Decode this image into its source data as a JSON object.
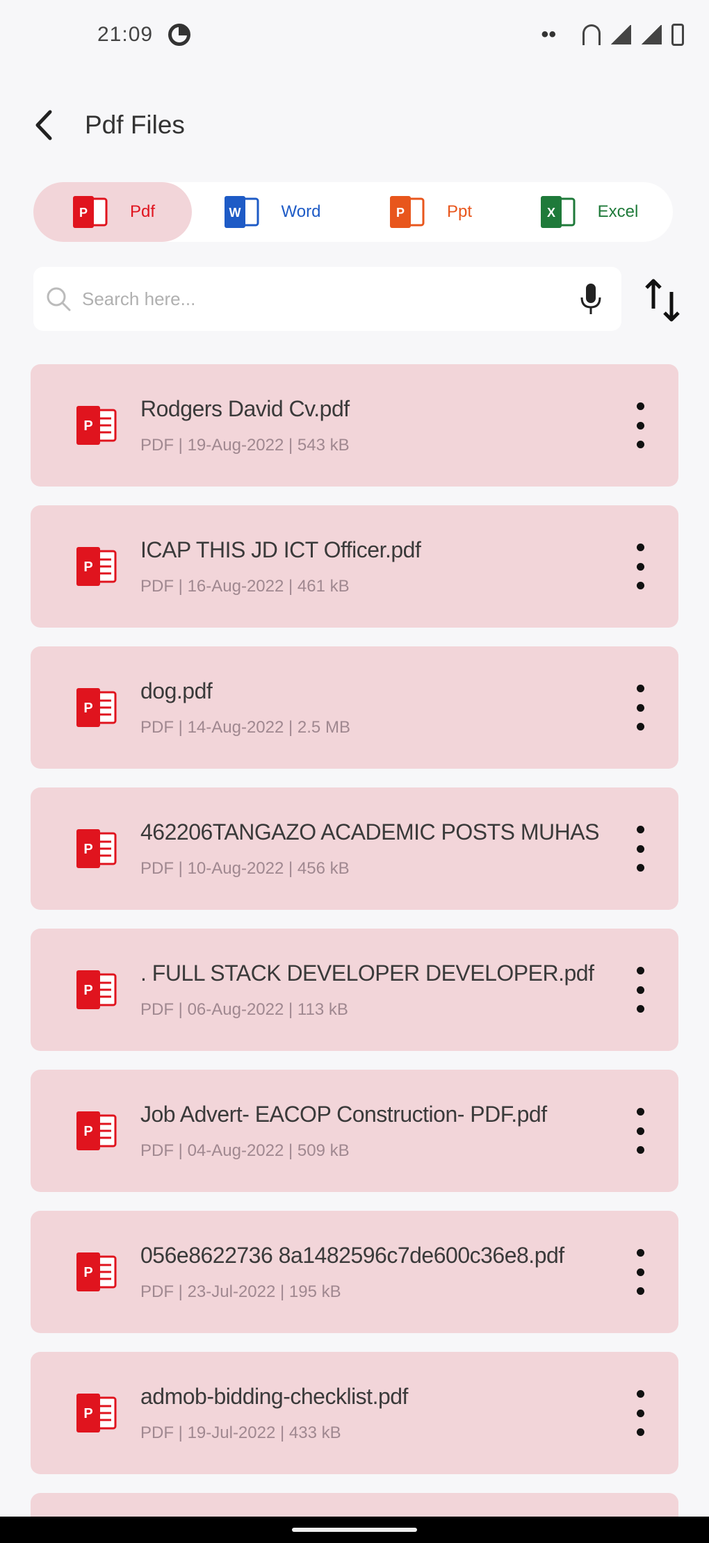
{
  "status_bar": {
    "time": "21:09",
    "icons": [
      "data-saver-icon",
      "more-icon",
      "wifi-icon",
      "signal-icon",
      "signal-icon",
      "battery-icon"
    ]
  },
  "header": {
    "title": "Pdf Files",
    "back_icon": "arrow-back-icon"
  },
  "tabs": [
    {
      "label": "Pdf",
      "icon": "pdf-icon",
      "color": "#e0141e",
      "active": true
    },
    {
      "label": "Word",
      "icon": "word-icon",
      "color": "#1e5bc6",
      "active": false
    },
    {
      "label": "Ppt",
      "icon": "ppt-icon",
      "color": "#e8561c",
      "active": false
    },
    {
      "label": "Excel",
      "icon": "excel-icon",
      "color": "#1f7a3a",
      "active": false
    }
  ],
  "search": {
    "placeholder": "Search here...",
    "value": ""
  },
  "files": [
    {
      "name": "Rodgers David Cv.pdf",
      "meta": "PDF  |  19-Aug-2022  |  543 kB"
    },
    {
      "name": "ICAP THIS JD ICT Officer.pdf",
      "meta": "PDF  |  16-Aug-2022  |  461 kB"
    },
    {
      "name": "dog.pdf",
      "meta": "PDF  |  14-Aug-2022  |  2.5 MB"
    },
    {
      "name": "462206TANGAZO ACADEMIC POSTS MUHAS",
      "meta": "PDF  |  10-Aug-2022  |  456 kB"
    },
    {
      "name": ". FULL STACK DEVELOPER DEVELOPER.pdf",
      "meta": "PDF  |  06-Aug-2022  |  113 kB"
    },
    {
      "name": "Job Advert- EACOP Construction- PDF.pdf",
      "meta": "PDF  |  04-Aug-2022  |  509 kB"
    },
    {
      "name": "056e8622736 8a1482596c7de600c36e8.pdf",
      "meta": "PDF  |  23-Jul-2022  |  195 kB"
    },
    {
      "name": "admob-bidding-checklist.pdf",
      "meta": "PDF  |  19-Jul-2022  |  433 kB"
    }
  ],
  "colors": {
    "accent": "#e0141e",
    "card_bg": "#f2d5d9",
    "page_bg": "#f7f7f9"
  }
}
